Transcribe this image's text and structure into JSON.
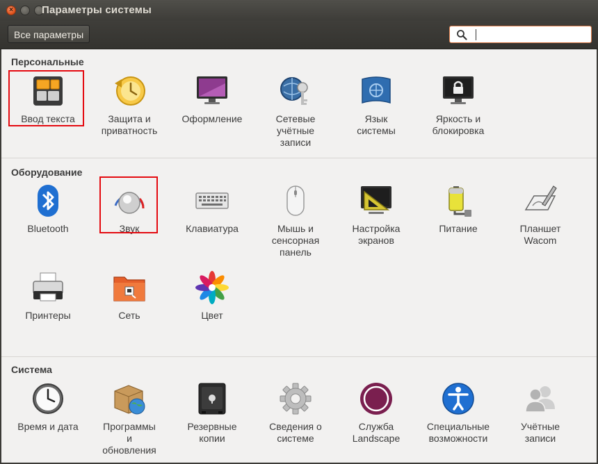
{
  "window": {
    "title": "Параметры системы",
    "close_glyph": "×",
    "colors": {
      "highlight": "#e4090f",
      "background": "#f2f1f0",
      "titlebar": "#3c3b37"
    }
  },
  "toolbar": {
    "all_settings_label": "Все параметры",
    "search_value": "",
    "search_icon": "search-icon"
  },
  "sections": {
    "personal": {
      "title": "Персональные",
      "items": [
        {
          "label": "Ввод текста",
          "icon": "keyboard-layout-icon",
          "highlighted": true
        },
        {
          "label": "Защита и\nприватность",
          "icon": "privacy-clock-icon"
        },
        {
          "label": "Оформление",
          "icon": "appearance-monitor-icon"
        },
        {
          "label": "Сетевые\nучётные\nзаписи",
          "icon": "online-accounts-key-icon"
        },
        {
          "label": "Язык\nсистемы",
          "icon": "language-flag-icon"
        },
        {
          "label": "Яркость и\nблокировка",
          "icon": "lock-screen-icon"
        }
      ]
    },
    "hardware": {
      "title": "Оборудование",
      "items": [
        {
          "label": "Bluetooth",
          "icon": "bluetooth-icon"
        },
        {
          "label": "Звук",
          "icon": "sound-knob-icon",
          "highlighted": true
        },
        {
          "label": "Клавиатура",
          "icon": "keyboard-icon"
        },
        {
          "label": "Мышь и\nсенсорная\nпанель",
          "icon": "mouse-icon"
        },
        {
          "label": "Настройка\nэкранов",
          "icon": "displays-icon"
        },
        {
          "label": "Питание",
          "icon": "battery-icon"
        },
        {
          "label": "Планшет\nWacom",
          "icon": "wacom-tablet-icon"
        },
        {
          "label": "Принтеры",
          "icon": "printer-icon"
        },
        {
          "label": "Сеть",
          "icon": "network-folder-icon"
        },
        {
          "label": "Цвет",
          "icon": "color-flower-icon"
        }
      ]
    },
    "system": {
      "title": "Система",
      "items": [
        {
          "label": "Время и дата",
          "icon": "clock-icon"
        },
        {
          "label": "Программы\nи\nобновления",
          "icon": "software-package-icon"
        },
        {
          "label": "Резервные\nкопии",
          "icon": "backup-safe-icon"
        },
        {
          "label": "Сведения о\nсистеме",
          "icon": "gear-icon"
        },
        {
          "label": "Служба\nLandscape",
          "icon": "landscape-ring-icon"
        },
        {
          "label": "Специальные\nвозможности",
          "icon": "accessibility-icon"
        },
        {
          "label": "Учётные\nзаписи",
          "icon": "user-accounts-icon"
        }
      ]
    }
  }
}
